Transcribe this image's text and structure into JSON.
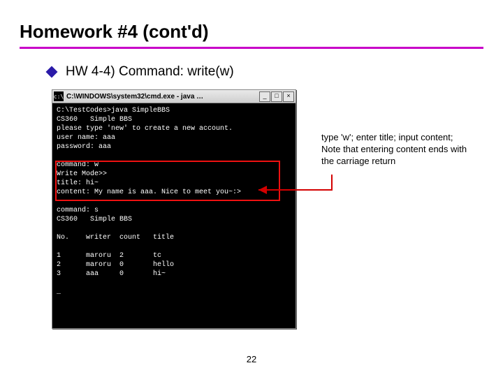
{
  "title": "Homework #4 (cont'd)",
  "bullet": "HW 4-4) Command: write(w)",
  "window": {
    "icon_glyph": "c:\\",
    "title": "C:\\WINDOWS\\system32\\cmd.exe - java …",
    "min": "_",
    "max": "□",
    "close": "×"
  },
  "terminal_lines": [
    "C:\\TestCodes>java SimpleBBS",
    "CS360   Simple BBS",
    "please type 'new' to create a new account.",
    "user name: aaa",
    "password: aaa",
    "",
    "command: w",
    "Write Mode>>",
    "title: hi~",
    "content: My name is aaa. Nice to meet you~:>",
    "",
    "command: s",
    "CS360   Simple BBS",
    "",
    "No.    writer  count   title",
    "",
    "1      maroru  2       tc",
    "2      maroru  0       hello",
    "3      aaa     0       hi~",
    "",
    "_"
  ],
  "note_lines": [
    "type 'w'; enter title; input content;",
    "Note that entering content ends with",
    "the carriage return"
  ],
  "page_number": "22"
}
